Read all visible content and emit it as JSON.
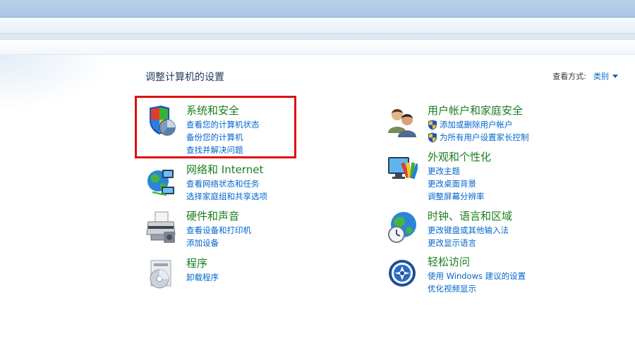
{
  "header": {
    "title": "调整计算机的设置",
    "view_by_label": "查看方式:",
    "view_by_value": "类别"
  },
  "categories": [
    {
      "id": "system-security",
      "icon": "shield-pie-icon",
      "title": "系统和安全",
      "links": [
        "查看您的计算机状态",
        "备份您的计算机",
        "查找并解决问题"
      ]
    },
    {
      "id": "network-internet",
      "icon": "network-globe-icon",
      "title": "网络和 Internet",
      "links": [
        "查看网络状态和任务",
        "选择家庭组和共享选项"
      ]
    },
    {
      "id": "hardware-sound",
      "icon": "printer-icon",
      "title": "硬件和声音",
      "links": [
        "查看设备和打印机",
        "添加设备"
      ]
    },
    {
      "id": "programs",
      "icon": "programs-disc-icon",
      "title": "程序",
      "links": [
        "卸载程序"
      ]
    },
    {
      "id": "user-accounts",
      "icon": "users-icon",
      "title": "用户帐户和家庭安全",
      "links": [
        "添加或删除用户帐户",
        "为所有用户设置家长控制"
      ]
    },
    {
      "id": "appearance",
      "icon": "monitor-palette-icon",
      "title": "外观和个性化",
      "links": [
        "更改主题",
        "更改桌面背景",
        "调整屏幕分辨率"
      ]
    },
    {
      "id": "clock-language",
      "icon": "globe-clock-icon",
      "title": "时钟、语言和区域",
      "links": [
        "更改键盘或其他输入法",
        "更改显示语言"
      ]
    },
    {
      "id": "ease-of-access",
      "icon": "ease-of-access-icon",
      "title": "轻松访问",
      "links": [
        "使用 Windows 建议的设置",
        "优化视频显示"
      ]
    }
  ],
  "colors": {
    "category_title": "#1a7e1e",
    "link": "#0066cc",
    "highlight": "#e01010"
  }
}
